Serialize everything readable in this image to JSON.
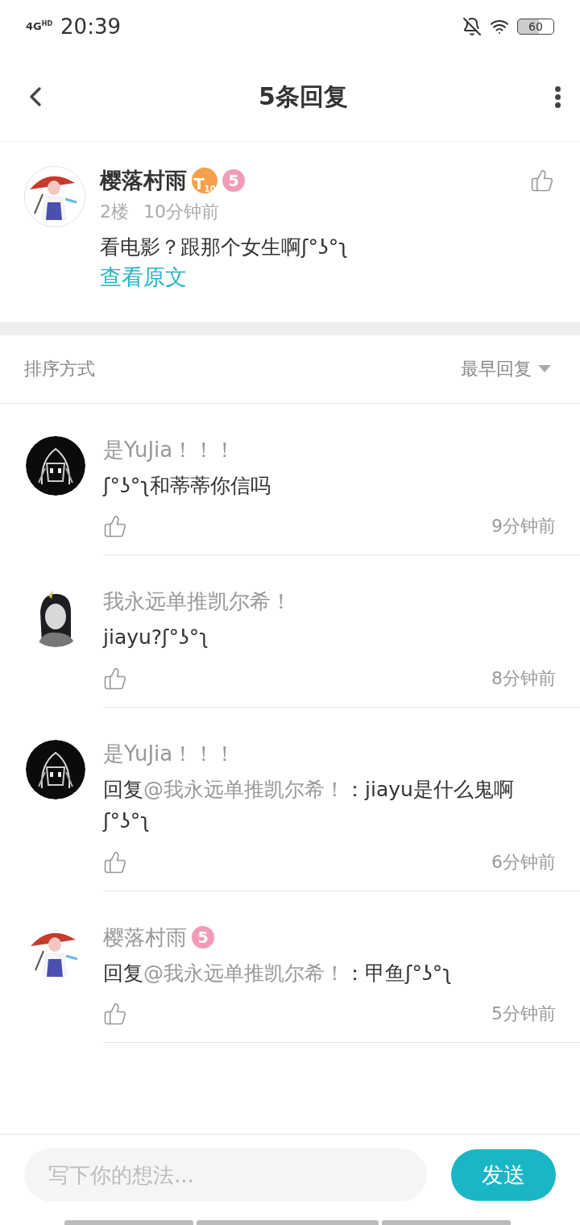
{
  "status_bar": {
    "network": "4G",
    "network_sup": "HD",
    "time": "20:39",
    "battery": "60"
  },
  "header": {
    "title": "5条回复"
  },
  "main_comment": {
    "author": "樱落村雨",
    "badges": [
      {
        "kind": "level",
        "text": "T",
        "sub": "10"
      },
      {
        "kind": "round",
        "text": "5"
      }
    ],
    "floor": "2楼",
    "time": "10分钟前",
    "text": "看电影？跟那个女生啊ʃ°ʖ°ʅ",
    "link": "查看原文"
  },
  "sort": {
    "label": "排序方式",
    "value": "最早回复"
  },
  "replies": [
    {
      "author": "是YuJia！！！",
      "text": "ʃ°ʖ°ʅ和蒂蒂你信吗",
      "time": "9分钟前"
    },
    {
      "author": "我永远单推凯尔希！",
      "text": "jiayu?ʃ°ʖ°ʅ",
      "time": "8分钟前"
    },
    {
      "author": "是YuJia！！！",
      "prefix": "回复",
      "mention": "@我永远单推凯尔希！",
      "text": "：jiayu是什么鬼啊ʃ°ʖ°ʅ",
      "time": "6分钟前"
    },
    {
      "author": "樱落村雨",
      "badges": [
        {
          "kind": "round",
          "text": "5"
        }
      ],
      "prefix": "回复",
      "mention": "@我永远单推凯尔希！",
      "text": "：甲鱼ʃ°ʖ°ʅ",
      "time": "5分钟前"
    }
  ],
  "input": {
    "placeholder": "写下你的想法...",
    "send": "发送"
  }
}
